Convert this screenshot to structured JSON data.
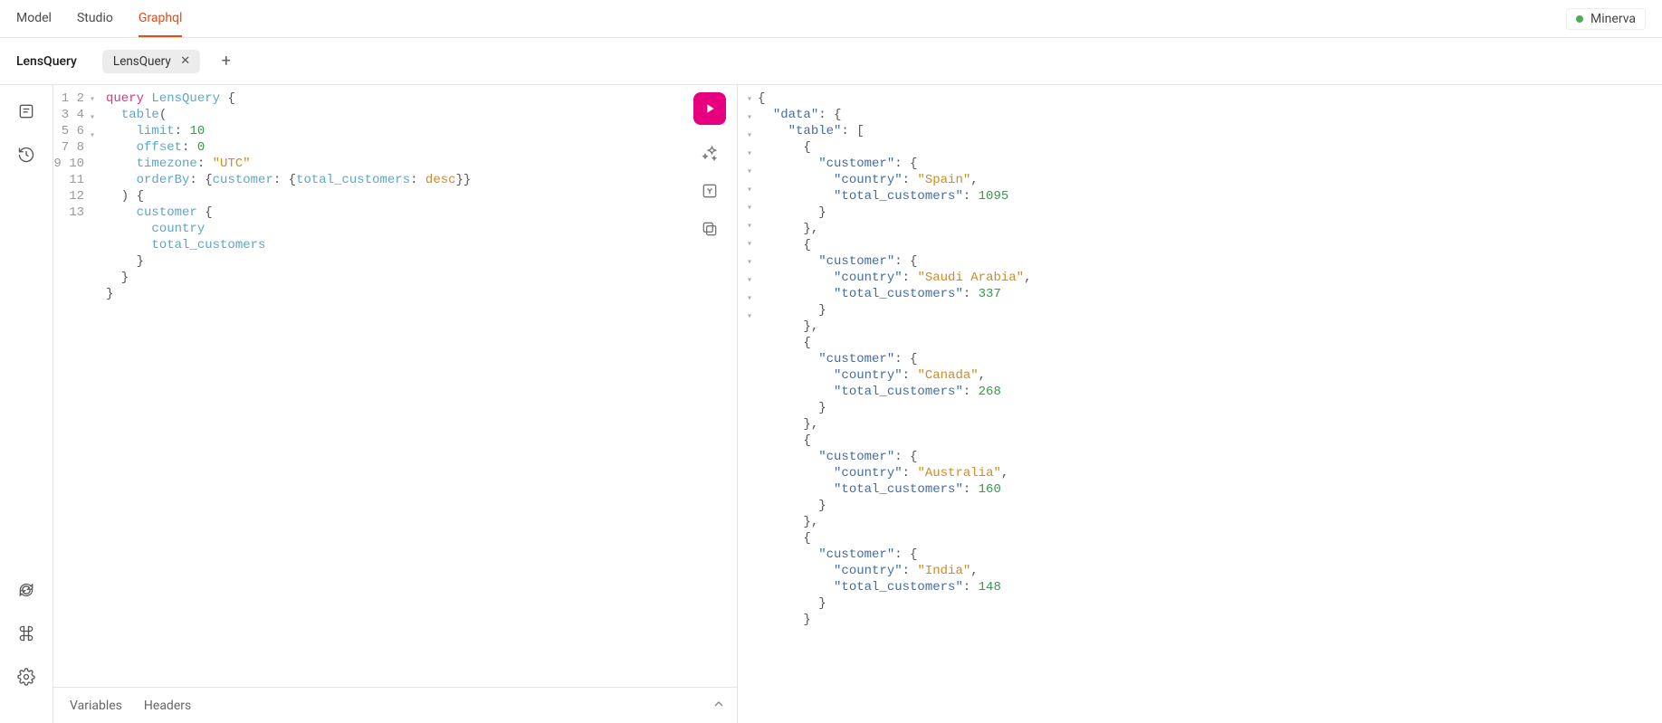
{
  "topnav": {
    "tabs": [
      "Model",
      "Studio",
      "Graphql"
    ],
    "active_index": 2
  },
  "user": {
    "name": "Minerva",
    "status": "Minerva"
  },
  "tabbar": {
    "title": "LensQuery",
    "tabs": [
      {
        "label": "LensQuery"
      }
    ]
  },
  "footer": {
    "variables": "Variables",
    "headers": "Headers"
  },
  "query": {
    "line_count": 13,
    "fold_markers": {
      "1": "▾",
      "7": "▾",
      "8": "▾"
    },
    "code_tokens": [
      [
        [
          "t-kw",
          "query"
        ],
        [
          "t-punc",
          " "
        ],
        [
          "t-name",
          "LensQuery"
        ],
        [
          "t-punc",
          " {"
        ]
      ],
      [
        [
          "t-punc",
          "  "
        ],
        [
          "t-attr",
          "table"
        ],
        [
          "t-punc",
          "("
        ]
      ],
      [
        [
          "t-punc",
          "    "
        ],
        [
          "t-attr",
          "limit"
        ],
        [
          "t-punc",
          ": "
        ],
        [
          "t-num",
          "10"
        ]
      ],
      [
        [
          "t-punc",
          "    "
        ],
        [
          "t-attr",
          "offset"
        ],
        [
          "t-punc",
          ": "
        ],
        [
          "t-num",
          "0"
        ]
      ],
      [
        [
          "t-punc",
          "    "
        ],
        [
          "t-attr",
          "timezone"
        ],
        [
          "t-punc",
          ": "
        ],
        [
          "t-str",
          "\"UTC\""
        ]
      ],
      [
        [
          "t-punc",
          "    "
        ],
        [
          "t-attr",
          "orderBy"
        ],
        [
          "t-punc",
          ": {"
        ],
        [
          "t-attr",
          "customer"
        ],
        [
          "t-punc",
          ": {"
        ],
        [
          "t-attr",
          "total_customers"
        ],
        [
          "t-punc",
          ": "
        ],
        [
          "t-enum",
          "desc"
        ],
        [
          "t-punc",
          "}}"
        ]
      ],
      [
        [
          "t-punc",
          "  ) {"
        ]
      ],
      [
        [
          "t-punc",
          "    "
        ],
        [
          "t-attr",
          "customer"
        ],
        [
          "t-punc",
          " {"
        ]
      ],
      [
        [
          "t-punc",
          "      "
        ],
        [
          "t-attr",
          "country"
        ]
      ],
      [
        [
          "t-punc",
          "      "
        ],
        [
          "t-attr",
          "total_customers"
        ]
      ],
      [
        [
          "t-punc",
          "    }"
        ]
      ],
      [
        [
          "t-punc",
          "  }"
        ]
      ],
      [
        [
          "t-punc",
          "}"
        ]
      ]
    ]
  },
  "response": {
    "data": {
      "table": [
        {
          "customer": {
            "country": "Spain",
            "total_customers": 1095
          }
        },
        {
          "customer": {
            "country": "Saudi Arabia",
            "total_customers": 337
          }
        },
        {
          "customer": {
            "country": "Canada",
            "total_customers": 268
          }
        },
        {
          "customer": {
            "country": "Australia",
            "total_customers": 160
          }
        },
        {
          "customer": {
            "country": "India",
            "total_customers": 148
          }
        }
      ]
    }
  }
}
